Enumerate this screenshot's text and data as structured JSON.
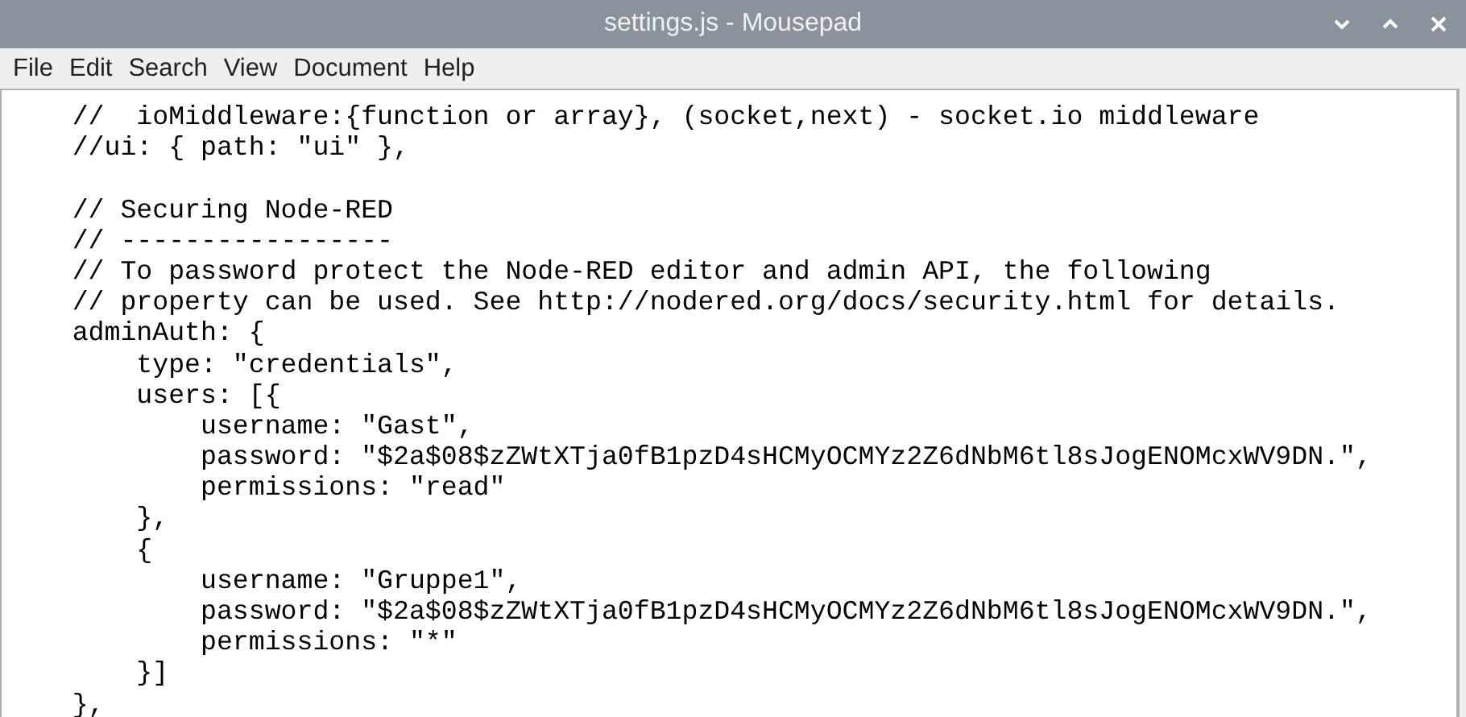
{
  "window": {
    "title": "settings.js - Mousepad"
  },
  "menu": [
    "File",
    "Edit",
    "Search",
    "View",
    "Document",
    "Help"
  ],
  "editor": {
    "blocks": [
      [
        "    //  ioMiddleware:{function or array}, (socket,next) - socket.io middleware",
        "    //ui: { path: \"ui\" },"
      ],
      [
        "    // Securing Node-RED",
        "    // -----------------",
        "    // To password protect the Node-RED editor and admin API, the following",
        "    // property can be used. See http://nodered.org/docs/security.html for details.",
        "    adminAuth: {",
        "        type: \"credentials\",",
        "        users: [{",
        "            username: \"Gast\",",
        "            password: \"$2a$08$zZWtXTja0fB1pzD4sHCMyOCMYz2Z6dNbM6tl8sJogENOMcxWV9DN.\",",
        "            permissions: \"read\"",
        "        },",
        "        {",
        "            username: \"Gruppe1\",",
        "            password: \"$2a$08$zZWtXTja0fB1pzD4sHCMyOCMYz2Z6dNbM6tl8sJogENOMcxWV9DN.\",",
        "            permissions: \"*\"",
        "        }]",
        "    },"
      ]
    ]
  }
}
